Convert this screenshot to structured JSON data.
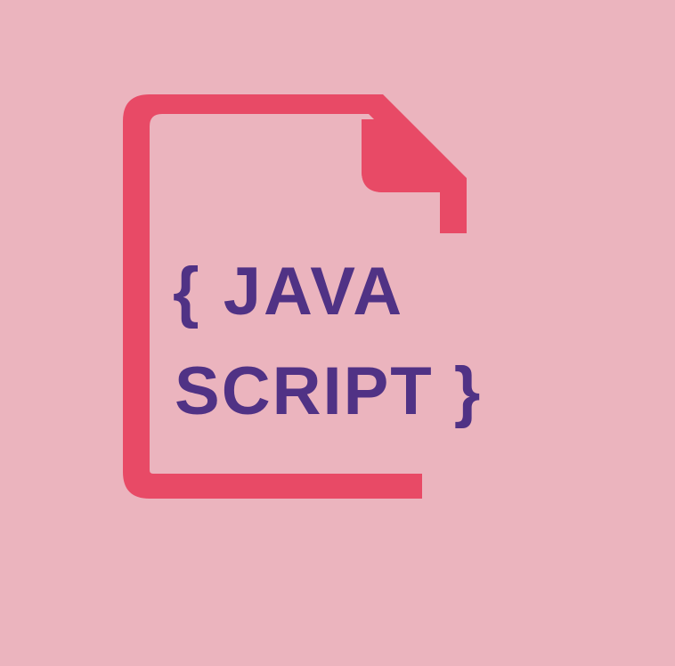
{
  "logo": {
    "line_1": "{ JAVA",
    "line_2": "SCRIPT }"
  },
  "colors": {
    "background": "#ebb4be",
    "icon": "#e84a66",
    "text": "#503285"
  },
  "icons": {
    "file_icon": "document-file-icon"
  }
}
